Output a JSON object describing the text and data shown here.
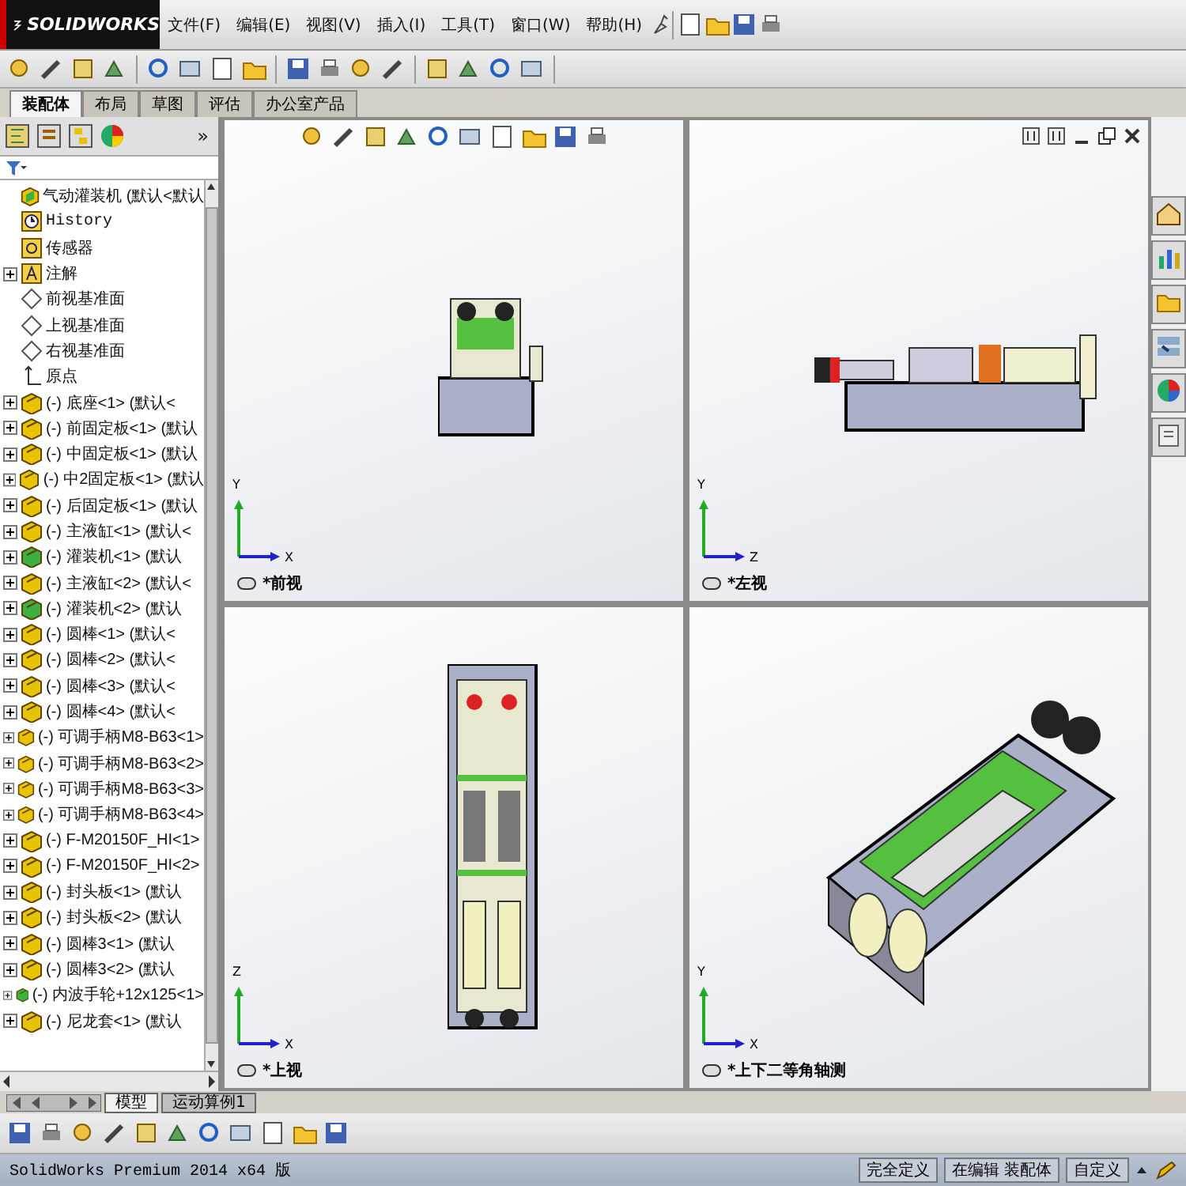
{
  "app": {
    "logo": "SOLIDWORKS",
    "menus": [
      "文件(F)",
      "编辑(E)",
      "视图(V)",
      "插入(I)",
      "工具(T)",
      "窗口(W)",
      "帮助(H)"
    ]
  },
  "command_tabs": [
    {
      "label": "装配体",
      "selected": true
    },
    {
      "label": "布局",
      "selected": false
    },
    {
      "label": "草图",
      "selected": false
    },
    {
      "label": "评估",
      "selected": false
    },
    {
      "label": "办公室产品",
      "selected": false
    }
  ],
  "panel": {
    "expand_button": "»"
  },
  "tree": [
    {
      "kind": "assembly",
      "label": "气动灌装机 (默认<默认"
    },
    {
      "kind": "history",
      "label": "History"
    },
    {
      "kind": "sensor",
      "label": "传感器"
    },
    {
      "kind": "annotation",
      "label": "注解",
      "expanded": false
    },
    {
      "kind": "plane",
      "label": "前视基准面"
    },
    {
      "kind": "plane",
      "label": "上视基准面"
    },
    {
      "kind": "plane",
      "label": "右视基准面"
    },
    {
      "kind": "origin",
      "label": "原点"
    },
    {
      "kind": "part",
      "label": "(-) 底座<1> (默认<",
      "expanded": false,
      "color": "#e8c400"
    },
    {
      "kind": "part",
      "label": "(-) 前固定板<1> (默认",
      "expanded": false,
      "color": "#e8c400"
    },
    {
      "kind": "part",
      "label": "(-) 中固定板<1> (默认",
      "expanded": false,
      "color": "#e8c400"
    },
    {
      "kind": "part",
      "label": "(-) 中2固定板<1> (默认",
      "expanded": false,
      "color": "#e8c400"
    },
    {
      "kind": "part",
      "label": "(-) 后固定板<1> (默认",
      "expanded": false,
      "color": "#e8c400"
    },
    {
      "kind": "part",
      "label": "(-) 主液缸<1> (默认<",
      "expanded": false,
      "color": "#e8c400"
    },
    {
      "kind": "part",
      "label": "(-) 灌装机<1> (默认",
      "expanded": false,
      "color": "#3cb043"
    },
    {
      "kind": "part",
      "label": "(-) 主液缸<2> (默认<",
      "expanded": false,
      "color": "#e8c400"
    },
    {
      "kind": "part",
      "label": "(-) 灌装机<2> (默认",
      "expanded": false,
      "color": "#3cb043"
    },
    {
      "kind": "part",
      "label": "(-) 圆棒<1> (默认<",
      "expanded": false,
      "color": "#e8c400"
    },
    {
      "kind": "part",
      "label": "(-) 圆棒<2> (默认<",
      "expanded": false,
      "color": "#e8c400"
    },
    {
      "kind": "part",
      "label": "(-) 圆棒<3> (默认<",
      "expanded": false,
      "color": "#e8c400"
    },
    {
      "kind": "part",
      "label": "(-) 圆棒<4> (默认<",
      "expanded": false,
      "color": "#e8c400"
    },
    {
      "kind": "part",
      "label": "(-) 可调手柄M8-B63<1>",
      "expanded": false,
      "color": "#e8c400"
    },
    {
      "kind": "part",
      "label": "(-) 可调手柄M8-B63<2>",
      "expanded": false,
      "color": "#e8c400"
    },
    {
      "kind": "part",
      "label": "(-) 可调手柄M8-B63<3>",
      "expanded": false,
      "color": "#e8c400"
    },
    {
      "kind": "part",
      "label": "(-) 可调手柄M8-B63<4>",
      "expanded": false,
      "color": "#e8c400"
    },
    {
      "kind": "part",
      "label": "(-) F-M20150F_HI<1>",
      "expanded": false,
      "color": "#e8c400"
    },
    {
      "kind": "part",
      "label": "(-) F-M20150F_HI<2>",
      "expanded": false,
      "color": "#e8c400"
    },
    {
      "kind": "part",
      "label": "(-) 封头板<1> (默认",
      "expanded": false,
      "color": "#e8c400"
    },
    {
      "kind": "part",
      "label": "(-) 封头板<2> (默认",
      "expanded": false,
      "color": "#e8c400"
    },
    {
      "kind": "part",
      "label": "(-) 圆棒3<1> (默认",
      "expanded": false,
      "color": "#e8c400"
    },
    {
      "kind": "part",
      "label": "(-) 圆棒3<2> (默认",
      "expanded": false,
      "color": "#e8c400"
    },
    {
      "kind": "part",
      "label": "(-) 内波手轮+12x125<1>",
      "expanded": false,
      "color": "#3cb043"
    },
    {
      "kind": "part",
      "label": "(-) 尼龙套<1> (默认",
      "expanded": false,
      "color": "#e8c400"
    }
  ],
  "views": [
    {
      "kind": "front",
      "label": "*前视",
      "axes": [
        "Y",
        "X"
      ]
    },
    {
      "kind": "left",
      "label": "*左视",
      "axes": [
        "Y",
        "Z"
      ]
    },
    {
      "kind": "top",
      "label": "*上视",
      "axes": [
        "Z",
        "X"
      ]
    },
    {
      "kind": "iso",
      "label": "*上下二等角轴测",
      "axes": [
        "Y",
        "X"
      ]
    }
  ],
  "bottom_tabs": [
    {
      "label": "模型",
      "selected": true
    },
    {
      "label": "运动算例1",
      "selected": false
    }
  ],
  "status_bar": {
    "product": "SolidWorks Premium 2014 x64 版",
    "fields": [
      "完全定义",
      "在编辑 装配体",
      "自定义"
    ]
  }
}
